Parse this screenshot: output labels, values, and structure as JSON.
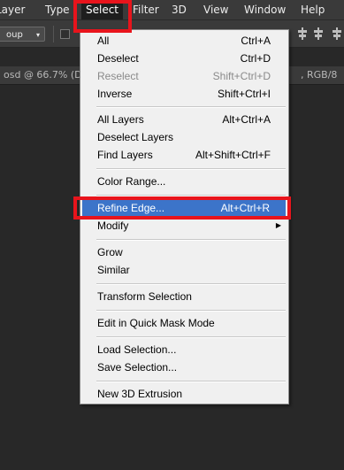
{
  "menubar": {
    "items": [
      {
        "label": "Layer"
      },
      {
        "label": "Type"
      },
      {
        "label": "Select"
      },
      {
        "label": "Filter"
      },
      {
        "label": "3D"
      },
      {
        "label": "View"
      },
      {
        "label": "Window"
      },
      {
        "label": "Help"
      }
    ]
  },
  "options_bar": {
    "group_dropdown": "oup",
    "icons": [
      "align-left-icon",
      "align-center-icon",
      "align-right-icon"
    ]
  },
  "doc_tab": {
    "title": "osd @ 66.7% (D",
    "mode": ", RGB/8"
  },
  "select_menu": {
    "items": [
      {
        "label": "All",
        "shortcut": "Ctrl+A"
      },
      {
        "label": "Deselect",
        "shortcut": "Ctrl+D"
      },
      {
        "label": "Reselect",
        "shortcut": "Shift+Ctrl+D"
      },
      {
        "label": "Inverse",
        "shortcut": "Shift+Ctrl+I"
      },
      {
        "label": "All Layers",
        "shortcut": "Alt+Ctrl+A"
      },
      {
        "label": "Deselect Layers",
        "shortcut": ""
      },
      {
        "label": "Find Layers",
        "shortcut": "Alt+Shift+Ctrl+F"
      },
      {
        "label": "Color Range...",
        "shortcut": ""
      },
      {
        "label": "Refine Edge...",
        "shortcut": "Alt+Ctrl+R"
      },
      {
        "label": "Modify",
        "shortcut": ""
      },
      {
        "label": "Grow",
        "shortcut": ""
      },
      {
        "label": "Similar",
        "shortcut": ""
      },
      {
        "label": "Transform Selection",
        "shortcut": ""
      },
      {
        "label": "Edit in Quick Mask Mode",
        "shortcut": ""
      },
      {
        "label": "Load Selection...",
        "shortcut": ""
      },
      {
        "label": "Save Selection...",
        "shortcut": ""
      },
      {
        "label": "New 3D Extrusion",
        "shortcut": ""
      }
    ]
  },
  "colors": {
    "highlight": "#3c74c9",
    "annotation": "#e8141c"
  }
}
